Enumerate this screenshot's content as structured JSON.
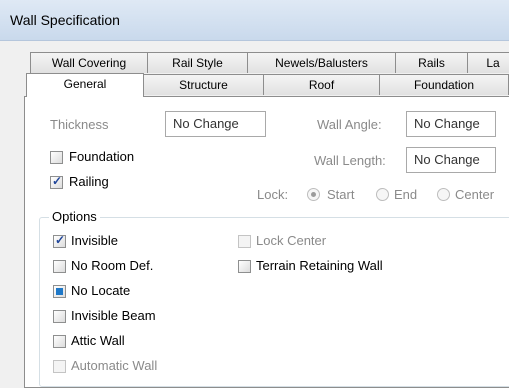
{
  "window": {
    "title": "Wall Specification"
  },
  "tabs_row1": [
    "Wall Covering",
    "Rail Style",
    "Newels/Balusters",
    "Rails",
    "La"
  ],
  "tabs_row2": [
    "General",
    "Structure",
    "Roof",
    "Foundation"
  ],
  "active_tab": "General",
  "general": {
    "thickness_label": "Thickness",
    "thickness_value": "No Change",
    "wall_angle_label": "Wall Angle:",
    "wall_angle_value": "No Change",
    "wall_length_label": "Wall Length:",
    "wall_length_value": "No Change",
    "foundation_label": "Foundation",
    "foundation_checked": false,
    "railing_label": "Railing",
    "railing_checked": true,
    "lock_label": "Lock:",
    "lock_options": [
      "Start",
      "End",
      "Center"
    ],
    "lock_selected": "Start"
  },
  "options": {
    "legend": "Options",
    "invisible": {
      "label": "Invisible",
      "state": "checked"
    },
    "no_room_def": {
      "label": "No Room Def.",
      "state": "unchecked"
    },
    "no_locate": {
      "label": "No Locate",
      "state": "indeterminate"
    },
    "invisible_beam": {
      "label": "Invisible Beam",
      "state": "unchecked"
    },
    "attic_wall": {
      "label": "Attic Wall",
      "state": "unchecked"
    },
    "automatic_wall": {
      "label": "Automatic Wall",
      "state": "disabled"
    },
    "lock_center": {
      "label": "Lock Center",
      "state": "disabled"
    },
    "terrain_retaining_wall": {
      "label": "Terrain Retaining Wall",
      "state": "unchecked"
    }
  }
}
